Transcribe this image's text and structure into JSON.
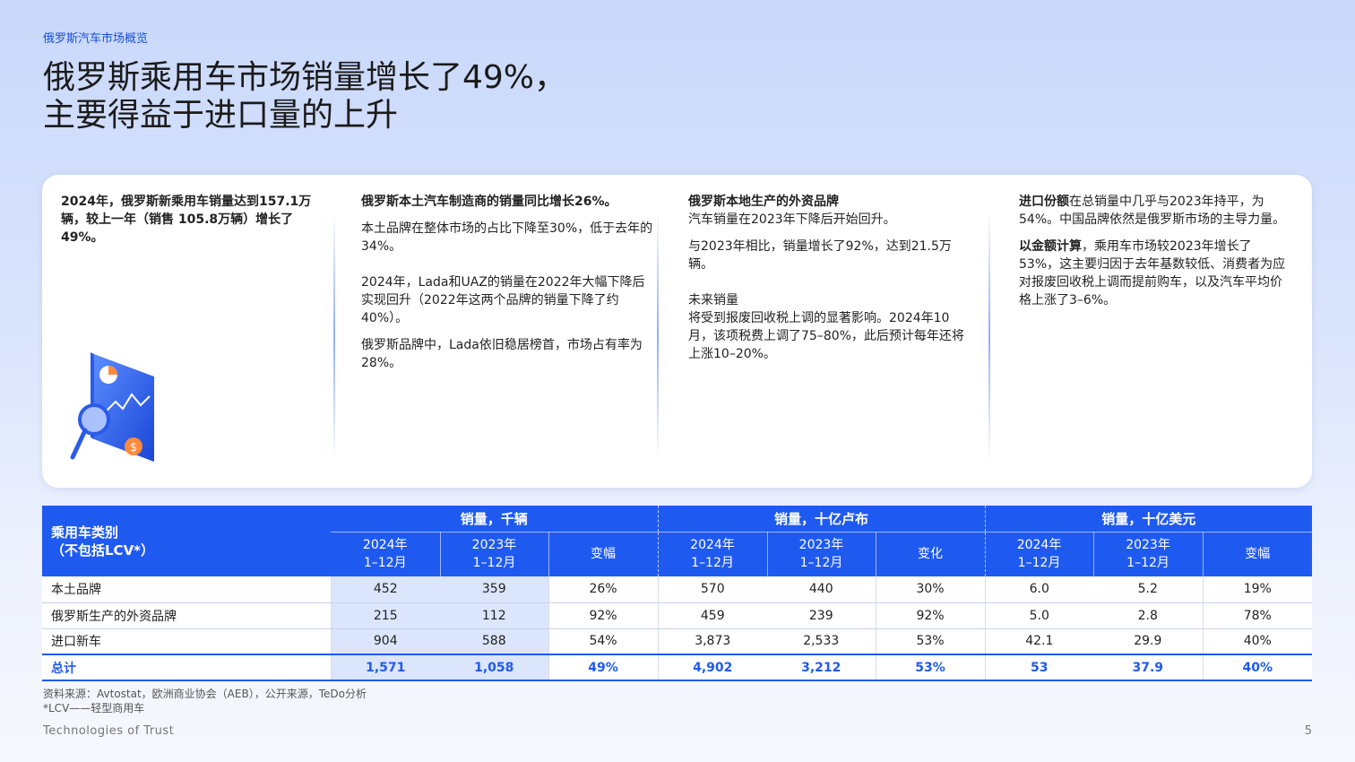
{
  "breadcrumb": "俄罗斯汽车市场概览",
  "title": {
    "line1": "俄罗斯乘用车市场销量增长了49%，",
    "line2": "主要得益于进口量的上升"
  },
  "card": {
    "col1": {
      "text": "2024年，俄罗斯新乘用车销量达到157.1万辆，较上一年（销售 105.8万辆）增长了 49%。"
    },
    "col2": {
      "heading": "俄罗斯本土汽车制造商的销量同比增长26%。",
      "p1": "本土品牌在整体市场的占比下降至30%，低于去年的34%。",
      "p2": "2024年，Lada和UAZ的销量在2022年大幅下降后实现回升（2022年这两个品牌的销量下降了约40%）。",
      "p3": "俄罗斯品牌中，Lada依旧稳居榜首，市场占有率为28%。"
    },
    "col3": {
      "heading": "俄罗斯本地生产的外资品牌",
      "p1": "汽车销量在2023年下降后开始回升。",
      "p2": "与2023年相比，销量增长了92%，达到21.5万辆。",
      "p3_title": "未来销量",
      "p3": "将受到报废回收税上调的显著影响。2024年10月，该项税费上调了75–80%，此后预计每年还将上涨10–20%。"
    },
    "col4": {
      "p1_bold": "进口份额",
      "p1": "在总销量中几乎与2023年持平，为54%。中国品牌依然是俄罗斯市场的主导力量。",
      "p2_bold": "以金额计算",
      "p2": "，乘用车市场较2023年增长了53%，这主要归因于去年基数较低、消费者为应对报废回收税上调而提前购车，以及汽车平均价格上涨了3–6%。"
    }
  },
  "table": {
    "category_header": "乘用车类别\n（不包括LCV*）",
    "groups": [
      "销量，千辆",
      "销量，十亿卢布",
      "销量，十亿美元"
    ],
    "sub_headers": [
      "2024年\n1–12月",
      "2023年\n1–12月",
      "变幅",
      "2024年\n1–12月",
      "2023年\n1–12月",
      "变化",
      "2024年\n1–12月",
      "2023年\n1–12月",
      "变幅"
    ],
    "rows": [
      {
        "label": "本土品牌",
        "cells": [
          "452",
          "359",
          "26%",
          "570",
          "440",
          "30%",
          "6.0",
          "5.2",
          "19%"
        ]
      },
      {
        "label": "俄罗斯生产的外资品牌",
        "cells": [
          "215",
          "112",
          "92%",
          "459",
          "239",
          "92%",
          "5.0",
          "2.8",
          "78%"
        ]
      },
      {
        "label": "进口新车",
        "cells": [
          "904",
          "588",
          "54%",
          "3,873",
          "2,533",
          "53%",
          "42.1",
          "29.9",
          "40%"
        ]
      }
    ],
    "total": {
      "label": "总计",
      "cells": [
        "1,571",
        "1,058",
        "49%",
        "4,902",
        "3,212",
        "53%",
        "53",
        "37.9",
        "40%"
      ]
    }
  },
  "source": {
    "line1": "资料来源：Avtostat，欧洲商业协会（AEB），公开来源，TeDo分析",
    "line2": "*LCV——轻型商用车"
  },
  "footer": {
    "left": "Technologies of Trust",
    "page": "5"
  },
  "colors": {
    "accent": "#1f5af0",
    "highlight": "#dbe5fb"
  }
}
